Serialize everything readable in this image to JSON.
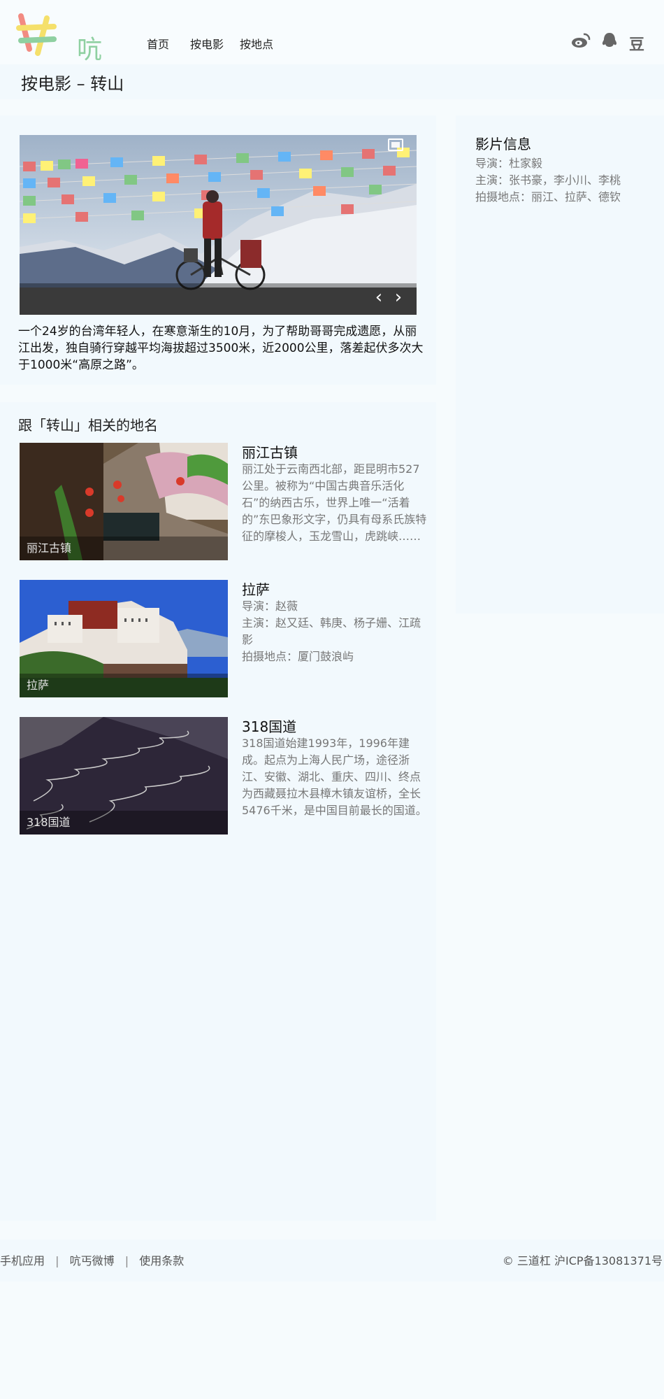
{
  "header": {
    "logo_text": "吭丐",
    "nav": [
      "首页",
      "按电影",
      "按地点"
    ],
    "social": [
      "weibo-icon",
      "qq-icon",
      "douban-icon"
    ],
    "douban_label": "豆"
  },
  "page": {
    "title": "按电影 – 转山"
  },
  "hero": {
    "caption": "一个24岁的台湾年轻人，在寒意渐生的10月，为了帮助哥哥完成遗愿，从丽江出发，独自骑行穿越平均海拔超过3500米，近2000公里，落差起伏多次大于1000米“高原之路”。",
    "prev_label": "‹",
    "next_label": "›"
  },
  "related": {
    "title": "跟「转山」相关的地名",
    "places": [
      {
        "name": "丽江古镇",
        "thumb_label": "丽江古镇",
        "desc": "丽江处于云南西北部，距昆明市527公里。被称为“中国古典音乐活化石”的纳西古乐，世界上唯一“活着的”东巴象形文字，仍具有母系氏族特征的摩梭人，玉龙雪山，虎跳峡……"
      },
      {
        "name": "拉萨",
        "thumb_label": "拉萨",
        "desc": "导演：赵薇\n主演：赵又廷、韩庚、杨子姗、江疏影\n拍摄地点：厦门鼓浪屿"
      },
      {
        "name": "318国道",
        "thumb_label": "318国道",
        "desc": "318国道始建1993年，1996年建成。起点为上海人民广场，途径浙江、安徽、湖北、重庆、四川、终点为西藏聂拉木县樟木镇友谊桥，全长5476千米，是中国目前最长的国道。"
      }
    ]
  },
  "film_info": {
    "title": "影片信息",
    "director": "导演：杜家毅",
    "cast": "主演：张书豪，李小川、李桃",
    "locations": "拍摄地点：丽江、拉萨、德钦"
  },
  "footer": {
    "links": [
      "手机应用",
      "吭丐微博",
      "使用条款"
    ],
    "separator": "|",
    "copyright": "© 三道杠 沪ICP备13081371号"
  },
  "colors": {
    "background": "#f6fbfd",
    "panel": "#f2f9fd",
    "logo_green": "#8fd0a1"
  }
}
